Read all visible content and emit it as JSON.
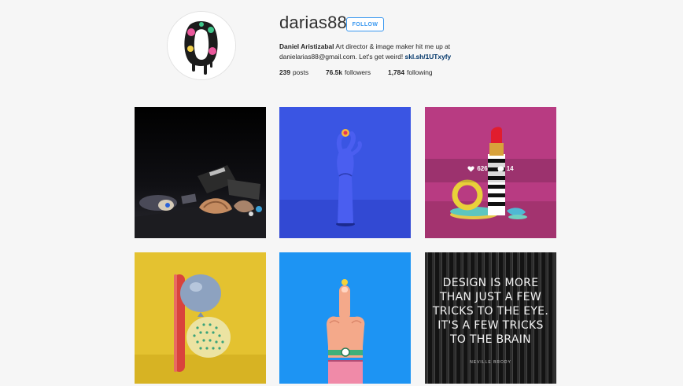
{
  "profile": {
    "username": "darias88",
    "follow_label": "FOLLOW",
    "bio": {
      "name": "Daniel Aristizabal",
      "text": " Art director & image maker hit me up at danielarias88@gmail.com. Let's get weird! ",
      "link": "skl.sh/1UTxyfy"
    },
    "stats": [
      {
        "value": "239",
        "label": "posts"
      },
      {
        "value": "76.5k",
        "label": "followers"
      },
      {
        "value": "1,784",
        "label": "following"
      }
    ]
  },
  "posts": [
    {
      "subject": "still life of shoes and shells on black"
    },
    {
      "subject": "blue hand on blue background"
    },
    {
      "subject": "lipstick and toys on magenta",
      "likes": "626",
      "comments": "14"
    },
    {
      "subject": "balloons on yellow"
    },
    {
      "subject": "finger with watch on blue"
    },
    {
      "subject": "typographic poster",
      "quote_lines": [
        "DESIGN IS MORE",
        "THAN JUST A FEW",
        "TRICKS TO THE EYE.",
        "IT'S A FEW TRICKS",
        "TO THE BRAIN"
      ],
      "signature": "NEVILLE BRODY"
    }
  ],
  "colors": {
    "accent": "#3897f0",
    "background": "#f6f6f6",
    "tile_blue": "#3a55e3",
    "tile_magenta": "#b83b82",
    "tile_yellow": "#e4c230",
    "tile_sky": "#1d94f3"
  },
  "icons": [
    "heart-icon",
    "comment-icon"
  ]
}
